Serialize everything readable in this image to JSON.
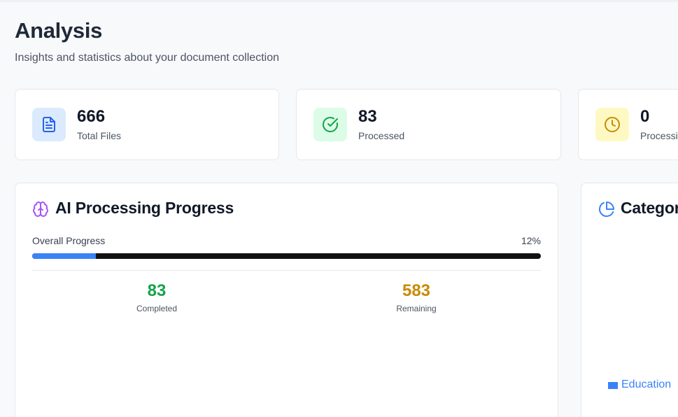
{
  "header": {
    "title": "Analysis",
    "subtitle": "Insights and statistics about your document collection"
  },
  "stats": [
    {
      "value": "666",
      "label": "Total Files",
      "icon": "document-icon",
      "bg": "#dbeafe",
      "fg": "#2563eb"
    },
    {
      "value": "83",
      "label": "Processed",
      "icon": "check-circle-icon",
      "bg": "#dcfce7",
      "fg": "#16a34a"
    },
    {
      "value": "0",
      "label": "Processing",
      "icon": "clock-icon",
      "bg": "#fef9c3",
      "fg": "#ca8a04"
    }
  ],
  "progress_panel": {
    "title": "AI Processing Progress",
    "icon": "brain-icon",
    "icon_color": "#a855f7",
    "overall_label": "Overall Progress",
    "percent_text": "12%",
    "percent_value": 0.125,
    "completed_value": "83",
    "completed_label": "Completed",
    "completed_color": "#16a34a",
    "remaining_value": "583",
    "remaining_label": "Remaining",
    "remaining_color": "#ca8a04"
  },
  "category_panel": {
    "title": "Categories",
    "icon": "pie-chart-icon",
    "legend": [
      {
        "label": "Education",
        "color": "#3b82f6"
      }
    ]
  }
}
